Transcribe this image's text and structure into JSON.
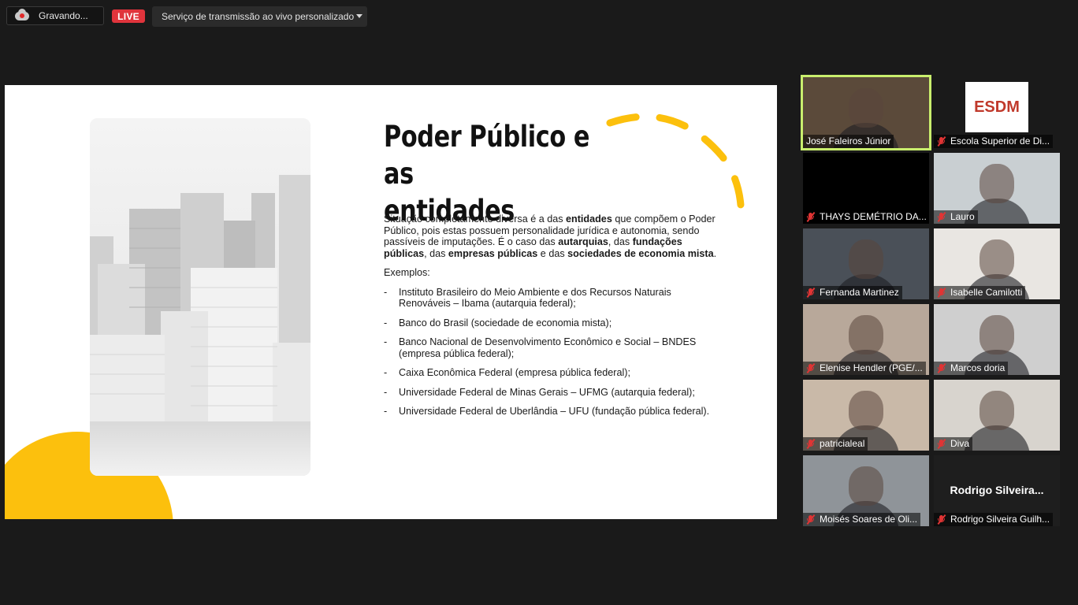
{
  "topbar": {
    "recording_label": "Gravando...",
    "live_label": "LIVE",
    "stream_service": "Serviço de transmissão ao vivo personalizado"
  },
  "slide": {
    "title_line1": "Poder Público e as",
    "title_line2": "entidades",
    "para": [
      {
        "t": "Situação completamente diversa é a das ",
        "b": false
      },
      {
        "t": "entidades",
        "b": true
      },
      {
        "t": " que compõem o Poder Público, pois estas possuem personalidade jurídica e autonomia, sendo passíveis de imputações. É o caso das ",
        "b": false
      },
      {
        "t": "autarquias",
        "b": true
      },
      {
        "t": ", das ",
        "b": false
      },
      {
        "t": "fundações públicas",
        "b": true
      },
      {
        "t": ", das ",
        "b": false
      },
      {
        "t": "empresas públicas",
        "b": true
      },
      {
        "t": " e das ",
        "b": false
      },
      {
        "t": "sociedades de economia mista",
        "b": true
      },
      {
        "t": ".",
        "b": false
      }
    ],
    "examples_label": "Exemplos:",
    "examples": [
      "Instituto Brasileiro do Meio Ambiente e dos Recursos Naturais Renováveis – Ibama (autarquia federal);",
      "Banco do Brasil (sociedade de economia mista);",
      "Banco Nacional de Desenvolvimento Econômico e Social – BNDES (empresa pública federal);",
      "Caixa Econômica Federal (empresa pública federal);",
      "Universidade Federal de Minas Gerais – UFMG (autarquia federal);",
      "Universidade Federal de Uberlândia – UFU (fundação pública federal)."
    ],
    "bullet": "-",
    "accent_color": "#fcc00d"
  },
  "participants": [
    {
      "name": "José Faleiros Júnior",
      "muted": false,
      "active": true,
      "bg": "#5b4a3a"
    },
    {
      "name": "Escola Superior de Di...",
      "muted": true,
      "logo": "ESDM",
      "bg": "#1a1a1a"
    },
    {
      "name": "THAYS DEMÉTRIO DA...",
      "muted": true,
      "bg": "#000000"
    },
    {
      "name": "Lauro",
      "muted": true,
      "bg": "#c9cfd2"
    },
    {
      "name": "Fernanda Martinez",
      "muted": true,
      "bg": "#4a5058"
    },
    {
      "name": "Isabelle Camilotti",
      "muted": true,
      "bg": "#e9e6e2"
    },
    {
      "name": "Elenise Hendler (PGE/...",
      "muted": true,
      "bg": "#b8a89a"
    },
    {
      "name": "Marcos doria",
      "muted": true,
      "bg": "#cfcfcf"
    },
    {
      "name": "patricialeal",
      "muted": true,
      "bg": "#c9b9a8"
    },
    {
      "name": "Diva",
      "muted": true,
      "bg": "#d8d4ce"
    },
    {
      "name": "Moisés Soares de Oli...",
      "muted": true,
      "bg": "#8f9499"
    },
    {
      "name": "Rodrigo Silveira Guilh...",
      "muted": true,
      "bigname": "Rodrigo  Silveira...",
      "bg": "#1e1e1e"
    }
  ]
}
